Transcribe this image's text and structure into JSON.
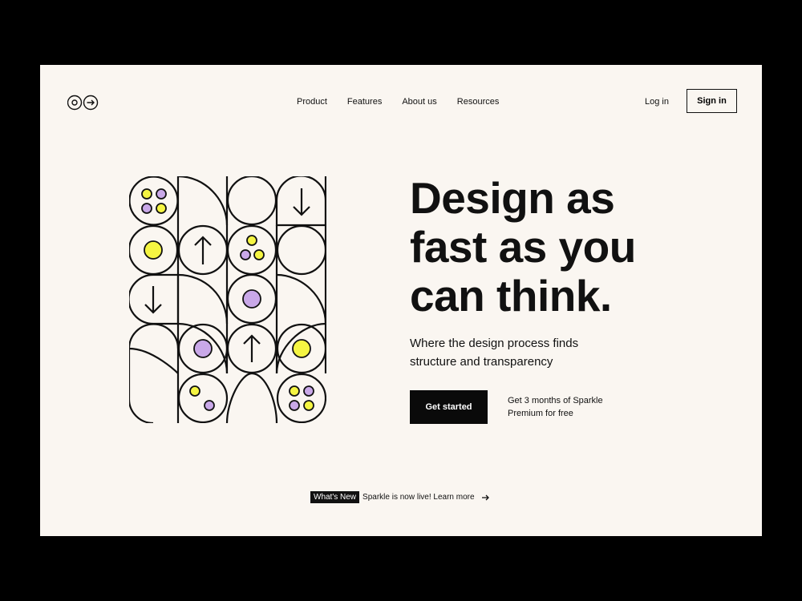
{
  "nav": {
    "items": [
      {
        "label": "Product"
      },
      {
        "label": "Features"
      },
      {
        "label": "About us"
      },
      {
        "label": "Resources"
      }
    ],
    "login": "Log in",
    "signin": "Sign in"
  },
  "hero": {
    "headline": "Design as fast as you can think.",
    "subtext": "Where the design process finds structure and transparency",
    "cta": "Get started",
    "promo": "Get 3 months of Sparkle Premium for free"
  },
  "banner": {
    "badge": "What's New",
    "text": "Sparkle is now live! Learn more"
  },
  "colors": {
    "background": "#faf6f1",
    "accent_yellow": "#f5f542",
    "accent_purple": "#c9a8e8",
    "ink": "#111111"
  }
}
